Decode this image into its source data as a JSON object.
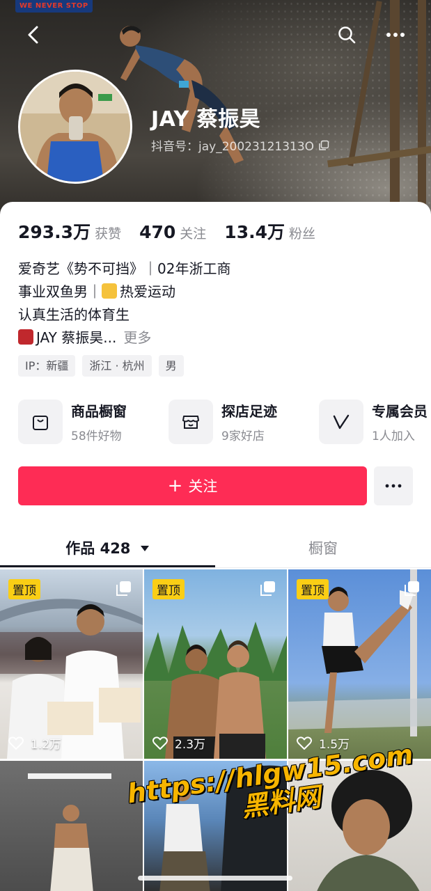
{
  "header": {
    "brand_logo_text": "WE NEVER STOP",
    "nickname": "JAY 蔡振昊",
    "douyin_id": "抖音号：jay_20023121313O"
  },
  "stats": [
    {
      "num": "293.3万",
      "label": "获赞"
    },
    {
      "num": "470",
      "label": "关注"
    },
    {
      "num": "13.4万",
      "label": "粉丝"
    }
  ],
  "bio": {
    "line1": "爱奇艺《势不可挡》｜02年浙工商",
    "line2_before": "事业双鱼男｜",
    "line2_after": "热爱运动",
    "line3": "认真生活的体育生",
    "line4": "JAY 蔡振昊...",
    "more": "更多"
  },
  "tags": [
    "IP：新疆",
    "浙江 · 杭州",
    "男"
  ],
  "services": [
    {
      "title": "商品橱窗",
      "sub": "58件好物",
      "icon": "shopping-bag-icon"
    },
    {
      "title": "探店足迹",
      "sub": "9家好店",
      "icon": "store-icon"
    },
    {
      "title": "专属会员",
      "sub": "1人加入",
      "icon": "vip-v-icon"
    }
  ],
  "actions": {
    "follow": "关注",
    "follow_prefix": "+"
  },
  "tabs": {
    "works": "作品 428",
    "showcase": "橱窗"
  },
  "videos": [
    {
      "pinned": "置顶",
      "likes": "1.2万"
    },
    {
      "pinned": "置顶",
      "likes": "2.3万"
    },
    {
      "pinned": "置顶",
      "likes": "1.5万"
    },
    {
      "pinned": "",
      "likes": ""
    },
    {
      "pinned": "",
      "likes": ""
    },
    {
      "pinned": "",
      "likes": ""
    }
  ],
  "watermark": {
    "line1": "https://hlgw15.com",
    "line2": "黑料网"
  },
  "colors": {
    "accent": "#fe2c55",
    "pin": "#face15",
    "muted": "#8a8b91"
  }
}
